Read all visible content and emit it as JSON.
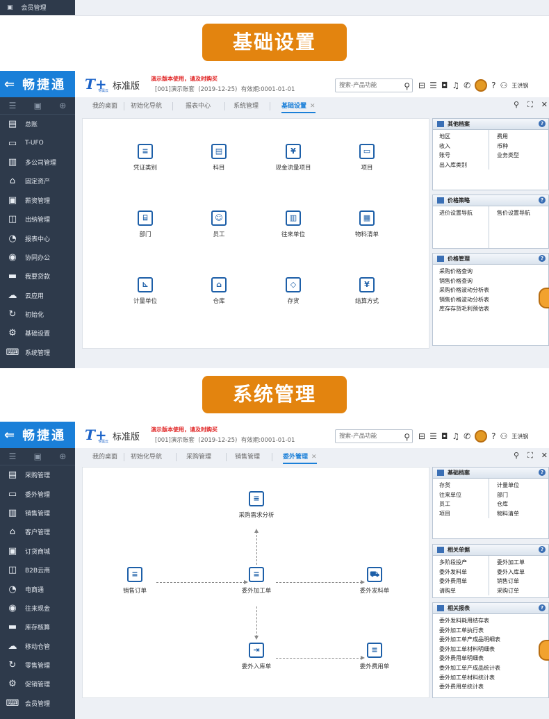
{
  "top_remnant": {
    "label": "会员管理"
  },
  "banner1": {
    "title": "基础设置"
  },
  "banner2": {
    "title": "系统管理"
  },
  "common": {
    "brand": "畅捷通",
    "product_logo": "T+",
    "product_logo_sub": "专属云",
    "edition": "标准版",
    "warning": "演示版本使用，请及时购买",
    "account": "[001]演示账套",
    "date": "(2019-12-25)",
    "validity": "有效期:0001-01-01",
    "search_placeholder": "搜索-产品功能",
    "user": "王洪钢"
  },
  "screen1": {
    "tabs": [
      "我的桌面",
      "初始化导航",
      "报表中心",
      "系统管理",
      "基础设置"
    ],
    "sidebar": [
      {
        "label": "总账",
        "icon": "ledger-icon"
      },
      {
        "label": "T-UFO",
        "icon": "ufo-icon"
      },
      {
        "label": "多公司管理",
        "icon": "company-icon"
      },
      {
        "label": "固定资产",
        "icon": "bank-icon"
      },
      {
        "label": "薪资管理",
        "icon": "salary-icon"
      },
      {
        "label": "出纳管理",
        "icon": "cashier-icon"
      },
      {
        "label": "报表中心",
        "icon": "report-icon"
      },
      {
        "label": "协同办公",
        "icon": "collab-icon"
      },
      {
        "label": "我要贷款",
        "icon": "loan-icon"
      },
      {
        "label": "云应用",
        "icon": "cloud-icon"
      },
      {
        "label": "初始化",
        "icon": "init-icon"
      },
      {
        "label": "基础设置",
        "icon": "settings-icon"
      },
      {
        "label": "系统管理",
        "icon": "system-icon"
      }
    ],
    "tiles": [
      "凭证类别",
      "科目",
      "现金流量项目",
      "项目",
      "部门",
      "员工",
      "往来单位",
      "物料清单",
      "计量单位",
      "仓库",
      "存货",
      "结算方式"
    ],
    "other_archives": {
      "title": "其他档案",
      "left": [
        "地区",
        "收入",
        "账号",
        "出入库类别"
      ],
      "right": [
        "费用",
        "币种",
        "业务类型"
      ]
    },
    "price_strategy": {
      "title": "价格策略",
      "left": [
        "进价设置导航"
      ],
      "right": [
        "售价设置导航"
      ]
    },
    "price_mgmt": {
      "title": "价格管理",
      "items": [
        "采购价格查询",
        "销售价格查询",
        "采购价格波动分析表",
        "销售价格波动分析表",
        "库存存货毛利预估表"
      ]
    }
  },
  "screen2": {
    "tabs": [
      "我的桌面",
      "初始化导航",
      "采购管理",
      "销售管理",
      "委外管理"
    ],
    "sidebar": [
      {
        "label": "采购管理",
        "icon": "purchase-icon"
      },
      {
        "label": "委外管理",
        "icon": "outsource-icon"
      },
      {
        "label": "销售管理",
        "icon": "sales-icon"
      },
      {
        "label": "客户管理",
        "icon": "customer-icon"
      },
      {
        "label": "订货商城",
        "icon": "mall-icon"
      },
      {
        "label": "B2B云商",
        "icon": "b2b-icon"
      },
      {
        "label": "电商通",
        "icon": "ecommerce-icon"
      },
      {
        "label": "往来现金",
        "icon": "cash-icon"
      },
      {
        "label": "库存核算",
        "icon": "inventory-icon"
      },
      {
        "label": "移动仓管",
        "icon": "mobile-warehouse-icon"
      },
      {
        "label": "零售管理",
        "icon": "retail-icon"
      },
      {
        "label": "促销管理",
        "icon": "promo-icon"
      },
      {
        "label": "会员管理",
        "icon": "member-icon"
      }
    ],
    "flow": {
      "demand": "采购需求分析",
      "sales_order": "销售订单",
      "process_order": "委外加工单",
      "dispatch": "委外发料单",
      "receipt": "委外入库单",
      "expense": "委外费用单"
    },
    "basic_archives": {
      "title": "基础档案",
      "left": [
        "存货",
        "往来单位",
        "员工",
        "项目"
      ],
      "right": [
        "计量单位",
        "部门",
        "仓库",
        "物料清单"
      ]
    },
    "related_docs": {
      "title": "相关单据",
      "left": [
        "多阶段投产",
        "委外发料单",
        "委外费用单",
        "请购单"
      ],
      "right": [
        "委外加工单",
        "委外入库单",
        "销售订单",
        "采购订单"
      ]
    },
    "related_reports": {
      "title": "相关报表",
      "items": [
        "委外发料耗用结存表",
        "委外加工单执行表",
        "委外加工单产成品明细表",
        "委外加工单材料明细表",
        "委外费用单明细表",
        "委外加工单产成品统计表",
        "委外加工单材料统计表",
        "委外费用单统计表"
      ]
    }
  }
}
